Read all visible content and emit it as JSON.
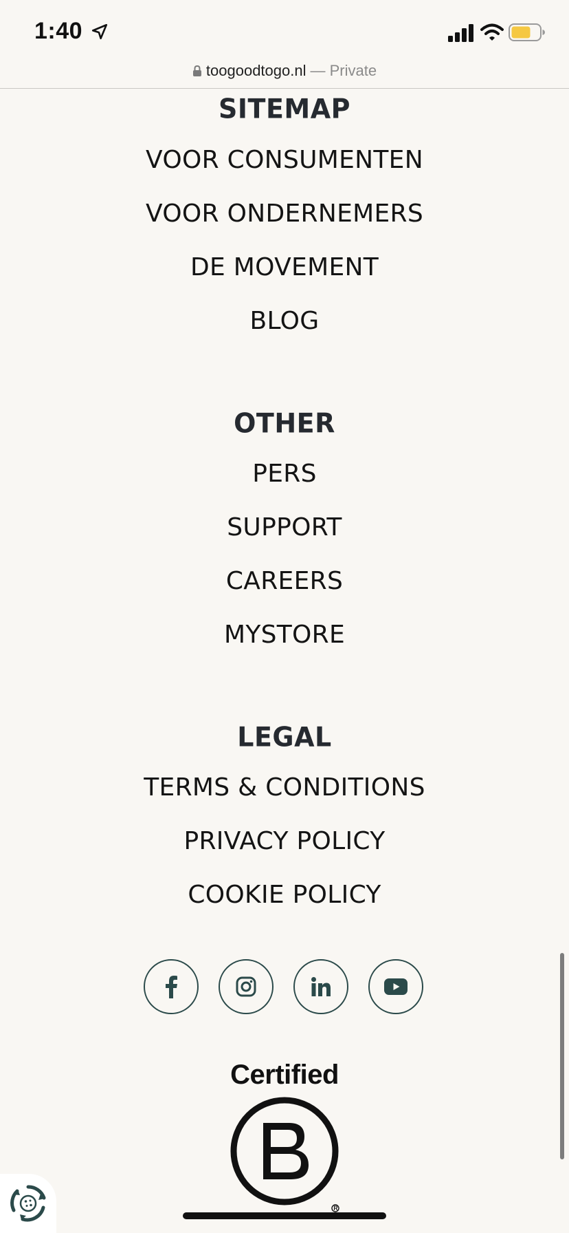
{
  "status_bar": {
    "time": "1:40",
    "location_icon": "location-arrow-icon",
    "signal_icon": "cellular-signal-icon",
    "wifi_icon": "wifi-icon",
    "battery_icon": "battery-icon",
    "battery_color": "#f5c842"
  },
  "url_bar": {
    "domain": "toogoodtogo.nl",
    "mode": "— Private",
    "lock_icon": "lock-icon"
  },
  "footer": {
    "sitemap": {
      "heading": "SITEMAP",
      "links": [
        "VOOR CONSUMENTEN",
        "VOOR ONDERNEMERS",
        "DE MOVEMENT",
        "BLOG"
      ]
    },
    "other": {
      "heading": "OTHER",
      "links": [
        "PERS",
        "SUPPORT",
        "CAREERS",
        "MYSTORE"
      ]
    },
    "legal": {
      "heading": "LEGAL",
      "links": [
        "TERMS & CONDITIONS",
        "PRIVACY POLICY",
        "COOKIE POLICY"
      ]
    },
    "social": [
      {
        "icon": "facebook-icon"
      },
      {
        "icon": "instagram-icon"
      },
      {
        "icon": "linkedin-icon"
      },
      {
        "icon": "youtube-icon"
      }
    ],
    "social_color": "#2b4a4a",
    "certified_label": "Certified",
    "bcorp_logo": "b-corp-logo"
  },
  "cookie_widget": {
    "icon": "cookie-settings-icon"
  }
}
